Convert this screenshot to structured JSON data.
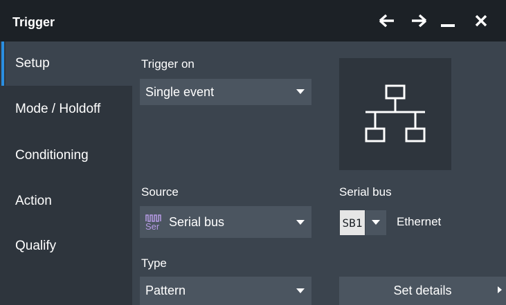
{
  "window": {
    "title": "Trigger"
  },
  "titlebar_icons": [
    "back-arrow-icon",
    "forward-arrow-icon",
    "minimize-icon",
    "close-icon"
  ],
  "sidebar": {
    "items": [
      {
        "label": "Setup",
        "active": true
      },
      {
        "label": "Mode / Holdoff",
        "active": false
      },
      {
        "label": "Conditioning",
        "active": false
      },
      {
        "label": "Action",
        "active": false
      },
      {
        "label": "Qualify",
        "active": false
      }
    ]
  },
  "trigger_on": {
    "label": "Trigger on",
    "value": "Single event"
  },
  "network_icon": "network-topology-icon",
  "source": {
    "label": "Source",
    "icon_text": "Ser",
    "value": "Serial bus"
  },
  "serial_bus": {
    "label": "Serial bus",
    "chip": "SB1",
    "protocol": "Ethernet"
  },
  "type": {
    "label": "Type",
    "value": "Pattern"
  },
  "set_details": {
    "label": "Set details"
  },
  "colors": {
    "titlebar": "#1c2126",
    "panel": "#3b444e",
    "sidebar": "#2e353d",
    "control": "#4b5560",
    "active_accent": "#2a8ee0",
    "serial_icon": "#b79ce6"
  }
}
